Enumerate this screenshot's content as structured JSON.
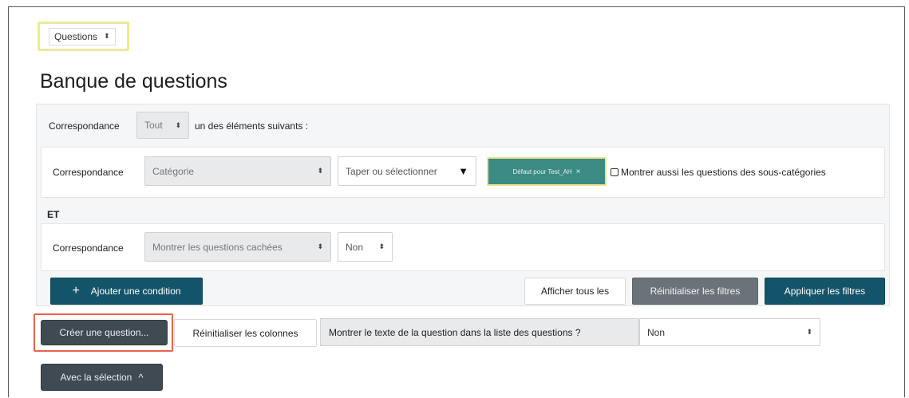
{
  "top_select": {
    "label": "Questions",
    "arrow": "⬍"
  },
  "page_title": "Banque de questions",
  "match_row": {
    "prefix": "Correspondance",
    "select_value": "Tout",
    "suffix": "un des éléments suivants :"
  },
  "condition1": {
    "label": "Correspondance",
    "type_select": "Catégorie",
    "search_placeholder": "Taper ou sélectionner",
    "selected_tag": "Défaut pour Test_AH",
    "tag_close": "×",
    "subcat_checkbox_label": "Montrer aussi les questions des sous-catégories"
  },
  "joiner": "ET",
  "condition2": {
    "label": "Correspondance",
    "type_select": "Montrer les questions cachées",
    "value_select": "Non"
  },
  "buttons": {
    "add_condition": "Ajouter une condition",
    "add_condition_icon": "+",
    "show_all": "Afficher tous les",
    "reset_filters": "Réinitialiser les filtres",
    "apply_filters": "Appliquer les filtres",
    "create_question": "Créer une question...",
    "reset_columns": "Réinitialiser les colonnes",
    "with_selection": "Avec la sélection",
    "with_selection_icon": "^"
  },
  "show_text_option": {
    "label": "Montrer le texte de la question dans la liste des questions ?",
    "value": "Non"
  },
  "colors": {
    "teal_button": "#14546a",
    "tag_bg": "#3b8a84",
    "highlight_outline": "#e8624a",
    "focus_yellow": "#f0e28a"
  }
}
